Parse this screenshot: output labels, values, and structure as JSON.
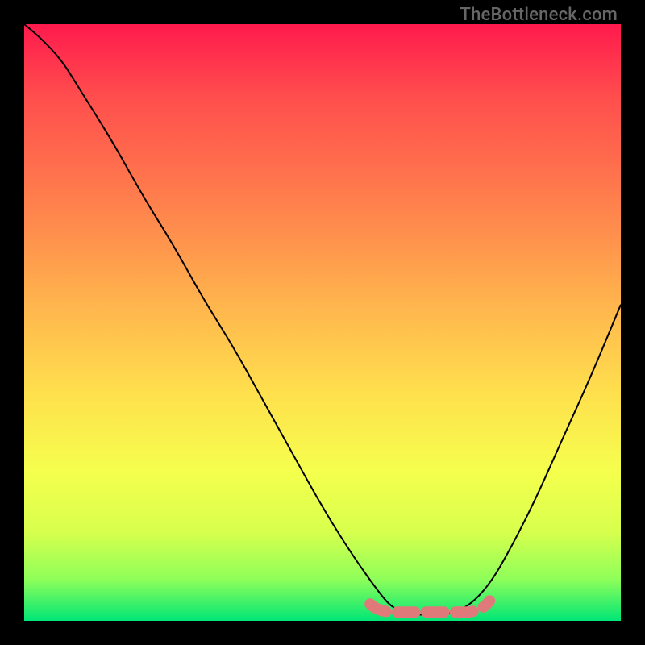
{
  "attribution": "TheBottleneck.com",
  "chart_data": {
    "type": "line",
    "title": "",
    "xlabel": "",
    "ylabel": "",
    "xlim": [
      0,
      1
    ],
    "ylim": [
      0,
      1
    ],
    "series": [
      {
        "name": "bottleneck-curve",
        "x": [
          0.0,
          0.05,
          0.1,
          0.15,
          0.2,
          0.25,
          0.3,
          0.35,
          0.4,
          0.45,
          0.5,
          0.55,
          0.6,
          0.62,
          0.65,
          0.7,
          0.74,
          0.78,
          0.82,
          0.86,
          0.9,
          0.95,
          1.0
        ],
        "y": [
          1.0,
          0.96,
          0.88,
          0.8,
          0.71,
          0.63,
          0.54,
          0.46,
          0.37,
          0.28,
          0.19,
          0.11,
          0.04,
          0.02,
          0.01,
          0.01,
          0.02,
          0.06,
          0.13,
          0.21,
          0.3,
          0.41,
          0.53
        ]
      }
    ],
    "highlight": {
      "name": "optimal-range",
      "x": [
        0.58,
        0.78
      ],
      "y": [
        0.02,
        0.02
      ],
      "color": "#e07a7a"
    },
    "background_gradient": [
      "#ff1a4d",
      "#ffe04d",
      "#00e676"
    ]
  }
}
